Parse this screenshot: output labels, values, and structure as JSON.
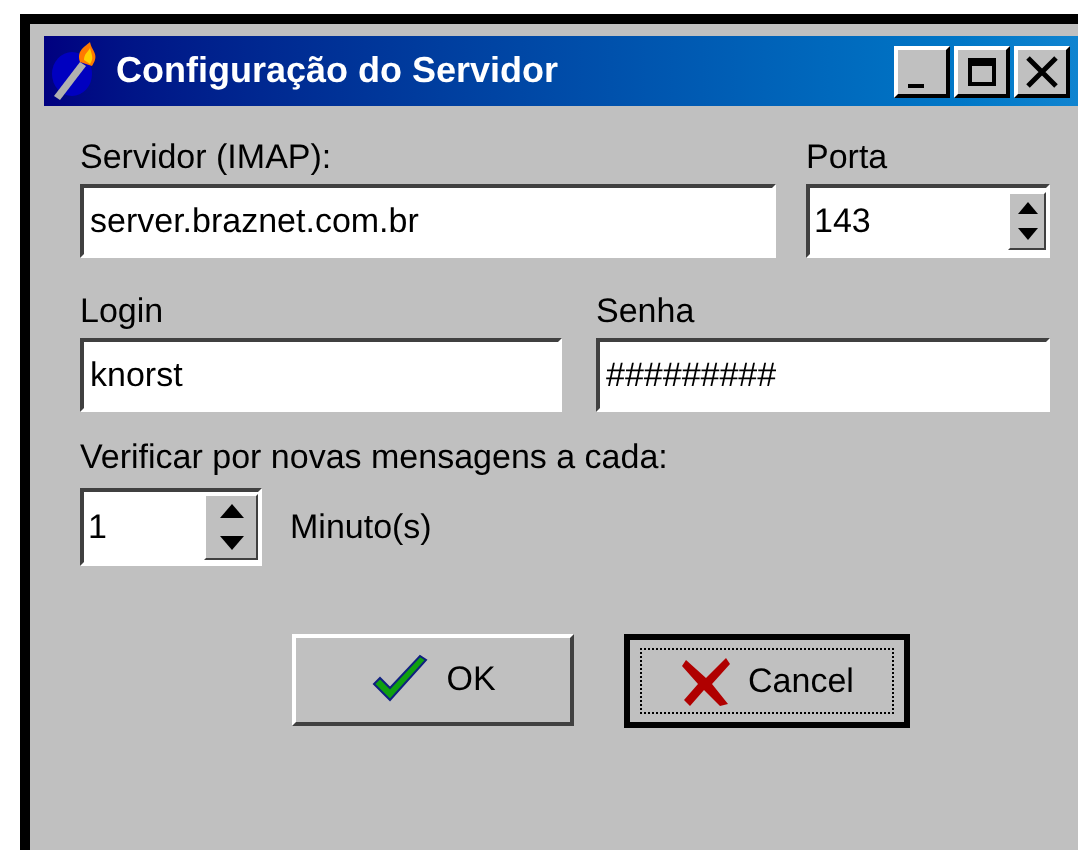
{
  "window": {
    "title": "Configuração do Servidor"
  },
  "title_buttons": [
    {
      "kind": "minimize"
    },
    {
      "kind": "maximize"
    },
    {
      "kind": "close"
    }
  ],
  "server": {
    "label": "Servidor (IMAP):",
    "value": "server.braznet.com.br"
  },
  "port": {
    "label": "Porta",
    "value": "143"
  },
  "login": {
    "label": "Login",
    "value": "knorst"
  },
  "password": {
    "label": "Senha",
    "value": "#########"
  },
  "interval": {
    "label": "Verificar por novas mensagens a cada:",
    "value": "1",
    "unit": "Minuto(s)"
  },
  "buttons": [
    {
      "kind": "ok",
      "label": "OK",
      "focused": false
    },
    {
      "kind": "cancel",
      "label": "Cancel",
      "focused": true
    }
  ]
}
